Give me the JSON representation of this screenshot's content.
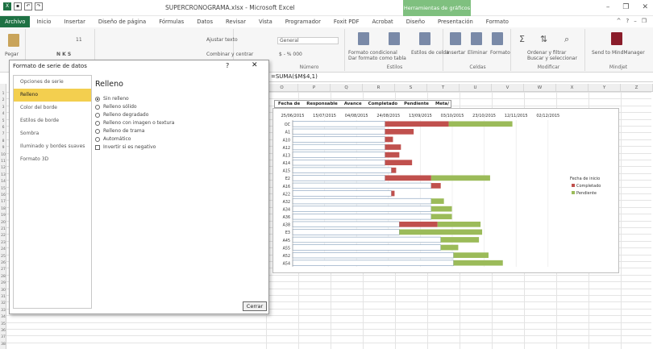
{
  "window": {
    "title": "SUPERCRONOGRAMA.xlsx - Microsoft Excel",
    "context_tab": "Herramientas de gráficos"
  },
  "tabs": [
    "Archivo",
    "Inicio",
    "Insertar",
    "Diseño de página",
    "Fórmulas",
    "Datos",
    "Revisar",
    "Vista",
    "Programador",
    "Foxit PDF",
    "Acrobat",
    "Diseño",
    "Presentación",
    "Formato"
  ],
  "ribbon": {
    "paste": "Pegar",
    "font_size": "11",
    "wrap_text": "Ajustar texto",
    "merge": "Combinar y centrar",
    "number_format": "General",
    "number_group": "Número",
    "styles_cond": "Formato condicional",
    "styles_table": "Dar formato como tabla",
    "styles_cell": "Estilos de celda",
    "styles_group": "Estilos",
    "cells_insert": "Insertar",
    "cells_delete": "Eliminar",
    "cells_format": "Formato",
    "cells_group": "Celdas",
    "edit_sort": "Ordenar y filtrar",
    "edit_find": "Buscar y seleccionar",
    "edit_group": "Modificar",
    "sendto": "Send to MindManager",
    "mindjet": "Mindjet"
  },
  "formula_bar": {
    "formula": "=SUMA($M$4,1)"
  },
  "columns": [
    "O",
    "P",
    "Q",
    "R",
    "S",
    "T",
    "U",
    "V",
    "W",
    "X",
    "Y",
    "Z"
  ],
  "rows": [
    "1",
    "2",
    "3",
    "4",
    "5",
    "6",
    "7",
    "8",
    "9",
    "10",
    "11",
    "12",
    "13",
    "14",
    "15",
    "16",
    "17",
    "18",
    "19",
    "20",
    "21",
    "22",
    "23",
    "24",
    "25",
    "26",
    "27",
    "28",
    "29",
    "30",
    "31",
    "32",
    "33",
    "34",
    "35",
    "36",
    "37",
    "38"
  ],
  "gantt_header": [
    "Fecha de",
    "Responsable",
    "Avance",
    "Completado",
    "Pendiente",
    "Meta/"
  ],
  "chart_data": {
    "type": "bar",
    "stacked": true,
    "orientation": "horizontal",
    "x_ticks": [
      "25/06/2015",
      "15/07/2015",
      "04/08/2015",
      "24/08/2015",
      "13/09/2015",
      "03/10/2015",
      "23/10/2015",
      "12/11/2015",
      "02/12/2015"
    ],
    "categories": [
      "OC",
      "A1",
      "A10",
      "A12",
      "A13",
      "A14",
      "A15",
      "E2",
      "A16",
      "A22",
      "A32",
      "A34",
      "A36",
      "A38",
      "E3",
      "A45",
      "A55",
      "A52",
      "A54"
    ],
    "series": [
      {
        "name": "Fecha de inicio",
        "color": "#ffffff",
        "values": [
          58,
          58,
          58,
          58,
          58,
          58,
          62,
          58,
          87,
          62,
          87,
          87,
          87,
          67,
          67,
          93,
          93,
          101,
          101
        ]
      },
      {
        "name": "Completado",
        "color": "#c0504d",
        "values": [
          40,
          18,
          5,
          10,
          9,
          17,
          3,
          29,
          6,
          2,
          0,
          0,
          0,
          24,
          0,
          0,
          0,
          0,
          0
        ]
      },
      {
        "name": "Pendiente",
        "color": "#9bbb59",
        "values": [
          40,
          0,
          0,
          0,
          0,
          0,
          0,
          37,
          0,
          0,
          8,
          13,
          13,
          27,
          52,
          24,
          11,
          22,
          31
        ]
      }
    ],
    "legend": [
      "Fecha de inicio",
      "Completado",
      "Pendiente"
    ],
    "legend_position": "right"
  },
  "dialog": {
    "title": "Formato de serie de datos",
    "help": "?",
    "close_x": "✕",
    "sidebar": [
      "Opciones de serie",
      "Relleno",
      "Color del borde",
      "Estilos de borde",
      "Sombra",
      "Iluminado y bordes suaves",
      "Formato 3D"
    ],
    "panel_title": "Relleno",
    "options": [
      "Sin relleno",
      "Relleno sólido",
      "Relleno degradado",
      "Relleno con imagen o textura",
      "Relleno de trama",
      "Automático"
    ],
    "checkbox": "Invertir si es negativo",
    "close_button": "Cerrar"
  }
}
